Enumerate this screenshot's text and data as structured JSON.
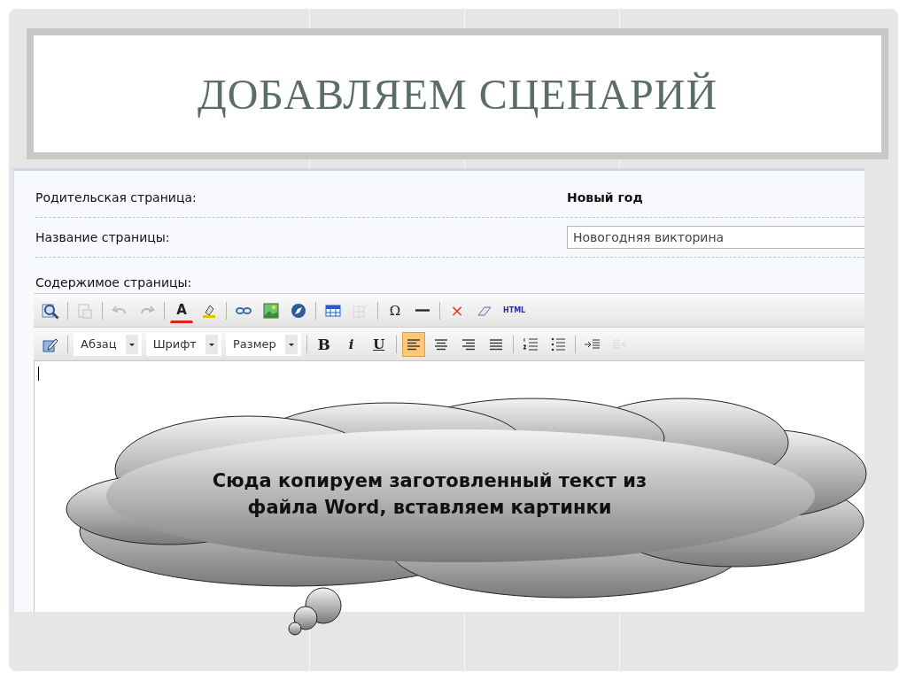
{
  "slide": {
    "title": "ДОБАВЛЯЕМ СЦЕНАРИЙ"
  },
  "form": {
    "rows": [
      {
        "kind": "value",
        "label": "Родительская страница:",
        "value": "Новый год"
      },
      {
        "kind": "input",
        "label": "Название страницы:",
        "value": "Новогодняя викторина"
      },
      {
        "kind": "heading",
        "label": "Содержимое страницы:"
      }
    ]
  },
  "toolbar_1": [
    {
      "kind": "icon",
      "disabled": false
    },
    {
      "kind": "separator"
    },
    {
      "kind": "icon",
      "disabled": true
    },
    {
      "kind": "separator"
    },
    {
      "kind": "icon",
      "disabled": true
    },
    {
      "kind": "icon",
      "disabled": true
    },
    {
      "kind": "separator"
    },
    {
      "kind": "glyph",
      "label": "A",
      "disabled": false
    },
    {
      "kind": "icon",
      "disabled": false
    },
    {
      "kind": "separator"
    },
    {
      "kind": "icon",
      "disabled": false
    },
    {
      "kind": "icon",
      "disabled": false
    },
    {
      "kind": "icon",
      "disabled": false
    },
    {
      "kind": "separator"
    },
    {
      "kind": "icon",
      "disabled": false
    },
    {
      "kind": "icon",
      "disabled": true
    },
    {
      "kind": "separator"
    },
    {
      "kind": "glyph",
      "label": "Ω",
      "disabled": false
    },
    {
      "kind": "icon",
      "disabled": false
    },
    {
      "kind": "separator"
    },
    {
      "kind": "glyph",
      "label": "×",
      "disabled": false
    },
    {
      "kind": "icon",
      "disabled": false
    },
    {
      "kind": "glyph",
      "label": "HTML",
      "disabled": false
    }
  ],
  "toolbar_2": [
    {
      "kind": "icon",
      "disabled": false
    },
    {
      "kind": "separator"
    },
    {
      "kind": "dropdown",
      "label": "Абзац"
    },
    {
      "kind": "dropdown",
      "label": "Шрифт"
    },
    {
      "kind": "dropdown",
      "label": "Размер"
    },
    {
      "kind": "separator"
    },
    {
      "kind": "glyph",
      "label": "B",
      "disabled": false
    },
    {
      "kind": "glyph",
      "label": "i",
      "disabled": false
    },
    {
      "kind": "glyph",
      "label": "U",
      "disabled": false
    },
    {
      "kind": "separator"
    },
    {
      "kind": "icon",
      "disabled": false,
      "selected": true
    },
    {
      "kind": "icon",
      "disabled": false,
      "selected": false
    },
    {
      "kind": "icon",
      "disabled": false,
      "selected": false
    },
    {
      "kind": "icon",
      "disabled": false,
      "selected": false
    },
    {
      "kind": "separator"
    },
    {
      "kind": "icon",
      "disabled": false
    },
    {
      "kind": "icon",
      "disabled": false
    },
    {
      "kind": "separator"
    },
    {
      "kind": "icon",
      "disabled": false
    },
    {
      "kind": "icon",
      "disabled": true
    }
  ],
  "callout": {
    "text": "Сюда копируем заготовленный текст из файла Word, вставляем картинки"
  }
}
